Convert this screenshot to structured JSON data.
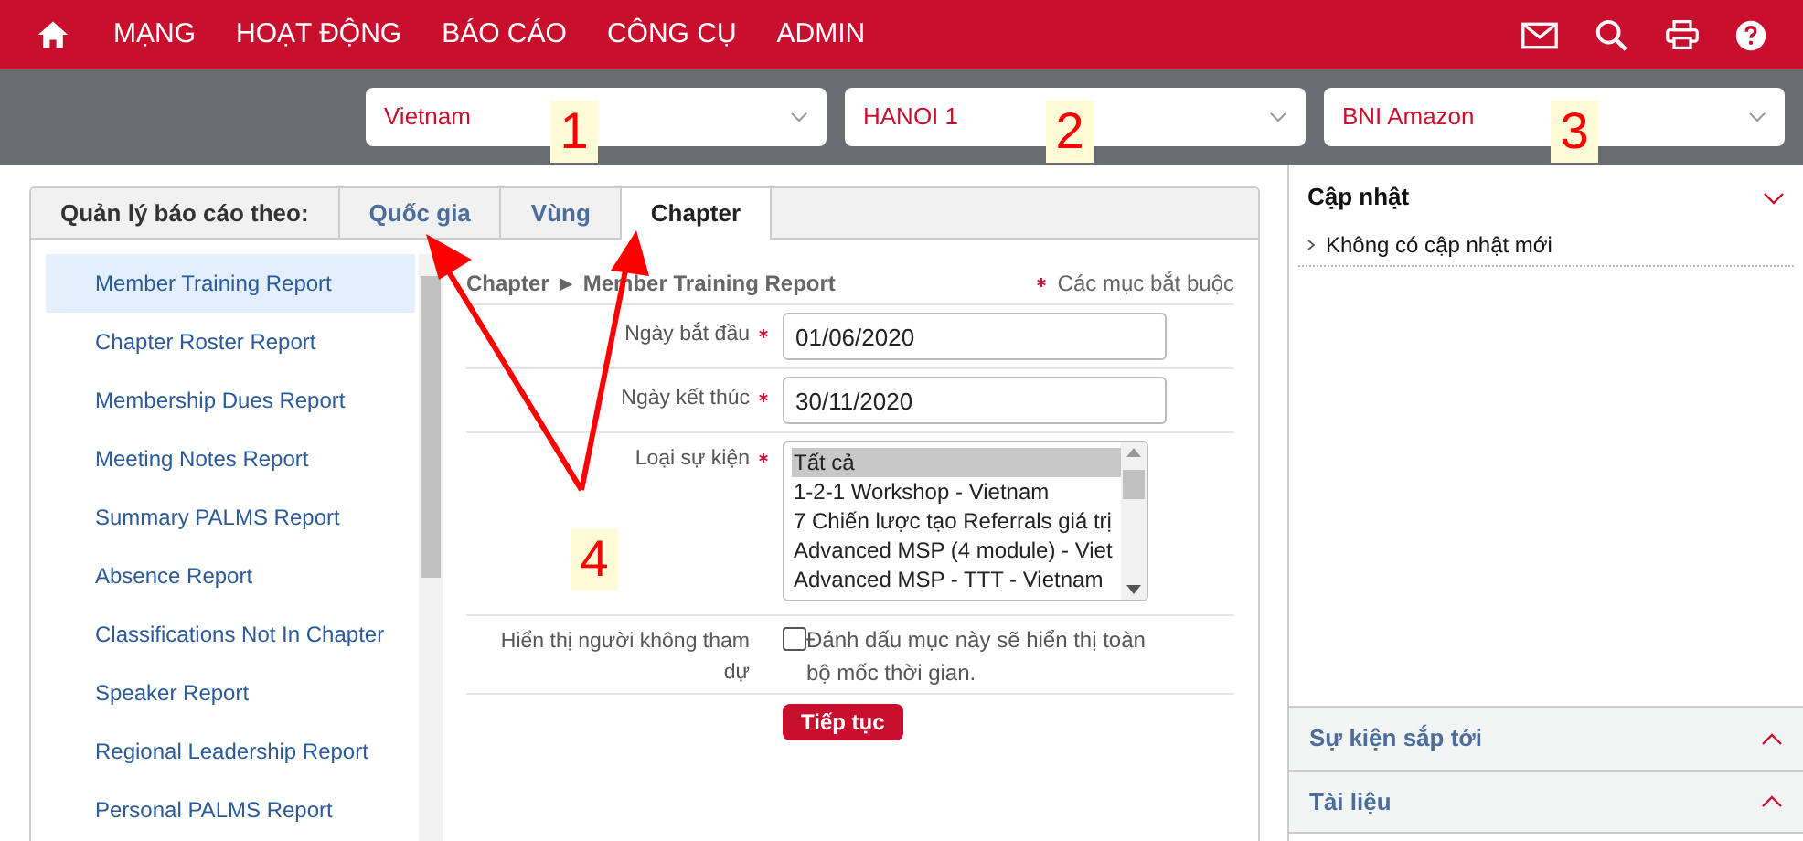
{
  "nav": {
    "items": [
      "MẠNG",
      "HOẠT ĐỘNG",
      "BÁO CÁO",
      "CÔNG CỤ",
      "ADMIN"
    ]
  },
  "selectors": [
    {
      "value": "Vietnam"
    },
    {
      "value": "HANOI 1"
    },
    {
      "value": "BNI Amazon"
    }
  ],
  "report_tabs": {
    "label": "Quản lý báo cáo theo:",
    "tabs": [
      {
        "label": "Quốc gia",
        "selected": false
      },
      {
        "label": "Vùng",
        "selected": false
      },
      {
        "label": "Chapter",
        "selected": true
      }
    ]
  },
  "reports": [
    {
      "label": "Member Training Report",
      "selected": true
    },
    {
      "label": "Chapter Roster Report",
      "selected": false
    },
    {
      "label": "Membership Dues Report",
      "selected": false
    },
    {
      "label": "Meeting Notes Report",
      "selected": false
    },
    {
      "label": "Summary PALMS Report",
      "selected": false
    },
    {
      "label": "Absence Report",
      "selected": false
    },
    {
      "label": "Classifications Not In Chapter",
      "selected": false
    },
    {
      "label": "Speaker Report",
      "selected": false
    },
    {
      "label": "Regional Leadership Report",
      "selected": false
    },
    {
      "label": "Personal PALMS Report",
      "selected": false
    }
  ],
  "form": {
    "breadcrumb": "Chapter ► Member Training Report",
    "required_note": "Các mục bắt buộc",
    "fields": [
      {
        "kind": "text",
        "label": "Ngày bắt đầu",
        "required": true,
        "value": "01/06/2020"
      },
      {
        "kind": "text",
        "label": "Ngày kết thúc",
        "required": true,
        "value": "30/11/2020"
      },
      {
        "kind": "listbox",
        "label": "Loại sự kiện",
        "required": true,
        "options": [
          {
            "label": "Tất cả",
            "selected": true
          },
          {
            "label": "1-2-1 Workshop - Vietnam",
            "selected": false
          },
          {
            "label": "7 Chiến lược tạo Referrals giá trị",
            "selected": false
          },
          {
            "label": "Advanced MSP (4 module) - Viet",
            "selected": false
          },
          {
            "label": "Advanced MSP - TTT - Vietnam",
            "selected": false
          }
        ]
      },
      {
        "kind": "checkbox",
        "label": "Hiển thị người không tham dự",
        "required": false,
        "checked": false,
        "text": "Đánh dấu mục này sẽ hiển thị toàn bộ mốc thời gian."
      }
    ],
    "submit": "Tiếp tục"
  },
  "side_panels": [
    {
      "title": "Cập nhật",
      "expanded": true,
      "items": [
        "Không có cập nhật mới"
      ]
    },
    {
      "title": "Sự kiện sắp tới",
      "expanded": false
    },
    {
      "title": "Tài liệu",
      "expanded": false
    }
  ],
  "annotations": [
    {
      "label": "1"
    },
    {
      "label": "2"
    },
    {
      "label": "3"
    },
    {
      "label": "4"
    }
  ]
}
